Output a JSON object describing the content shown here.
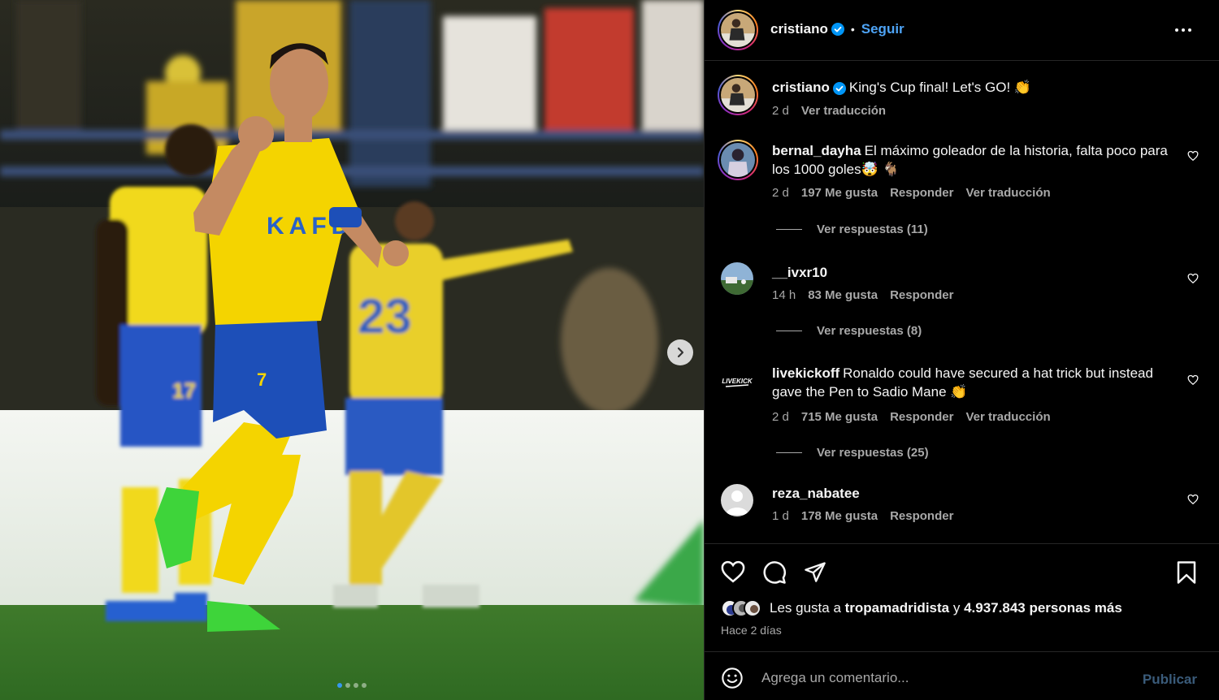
{
  "post": {
    "author": "cristiano",
    "separator": "•",
    "follow_label": "Seguir"
  },
  "caption": {
    "author": "cristiano",
    "text": "King's Cup final! Let's GO! 👏",
    "time": "2 d",
    "translate_label": "Ver traducción"
  },
  "comments": [
    {
      "user": "bernal_dayha",
      "text": "El máximo goleador de la historia, falta poco para los 1000 goles🤯 🐐",
      "time": "2 d",
      "likes": "197 Me gusta",
      "reply_label": "Responder",
      "translate_label": "Ver traducción",
      "replies_label": "Ver respuestas (11)"
    },
    {
      "user": "__ivxr10",
      "text": "",
      "time": "14 h",
      "likes": "83 Me gusta",
      "reply_label": "Responder",
      "replies_label": "Ver respuestas (8)"
    },
    {
      "user": "livekickoff",
      "text": "Ronaldo could have secured a hat trick but instead gave the Pen to Sadio Mane 👏",
      "time": "2 d",
      "likes": "715 Me gusta",
      "reply_label": "Responder",
      "translate_label": "Ver traducción",
      "replies_label": "Ver respuestas (25)"
    },
    {
      "user": "reza_nabatee",
      "text": "",
      "time": "1 d",
      "likes": "178 Me gusta",
      "reply_label": "Responder"
    }
  ],
  "likes_summary": {
    "prefix": "Les gusta a",
    "user": "tropamadridista",
    "connector": "y",
    "count": "4.937.843 personas más"
  },
  "posted_ago": "Hace 2 días",
  "comment_box": {
    "placeholder": "Agrega un comentario...",
    "publish_label": "Publicar"
  },
  "carousel": {
    "total": 4,
    "active": 1
  },
  "jersey": {
    "sponsor": "KAFD",
    "number_main": "7",
    "number_left": "17",
    "number_back": "23"
  },
  "livekickoff_logo": "LIVEKICK",
  "colors": {
    "accent": "#0095f6",
    "follow": "#4ea4f6",
    "jersey_yellow": "#f4d400",
    "shorts_blue": "#1d4fb8",
    "boots_green": "#3ed43a"
  },
  "icons": [
    "verified-icon",
    "more-icon",
    "heart-icon",
    "comment-icon",
    "share-icon",
    "bookmark-icon",
    "emoji-icon",
    "chevron-right-icon"
  ]
}
